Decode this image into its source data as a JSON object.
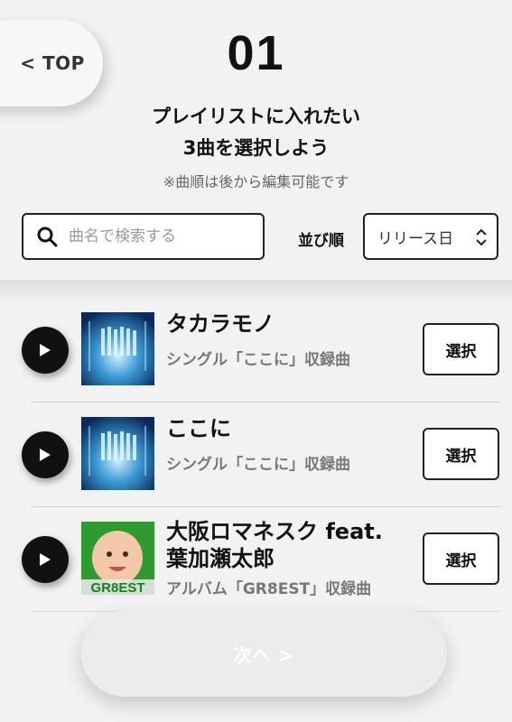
{
  "nav": {
    "top_label": "< TOP"
  },
  "step": {
    "number": "01"
  },
  "heading": {
    "line1": "プレイリストに入れたい",
    "line2": "3曲を選択しよう"
  },
  "note": "※曲順は後から編集可能です",
  "search": {
    "placeholder": "曲名で検索する",
    "value": ""
  },
  "sort": {
    "label": "並び順",
    "selected": "リリース日"
  },
  "songs": [
    {
      "title": "タカラモノ",
      "subtitle": "シングル「ここに」収録曲",
      "select_label": "選択",
      "cover": "single-cover"
    },
    {
      "title": "ここに",
      "subtitle": "シングル「ここに」収録曲",
      "select_label": "選択",
      "cover": "single-cover"
    },
    {
      "title_line1": "大阪ロマネスク feat.",
      "title_line2": "葉加瀬太郎",
      "subtitle": "アルバム「GR8EST」収録曲",
      "select_label": "選択",
      "cover": "album-cover",
      "cover_text": "GR8EST"
    }
  ],
  "next": {
    "label": "次へ >"
  },
  "colors": {
    "background": "#f2f2f2",
    "accent": "#111111",
    "subtext": "#777777"
  }
}
